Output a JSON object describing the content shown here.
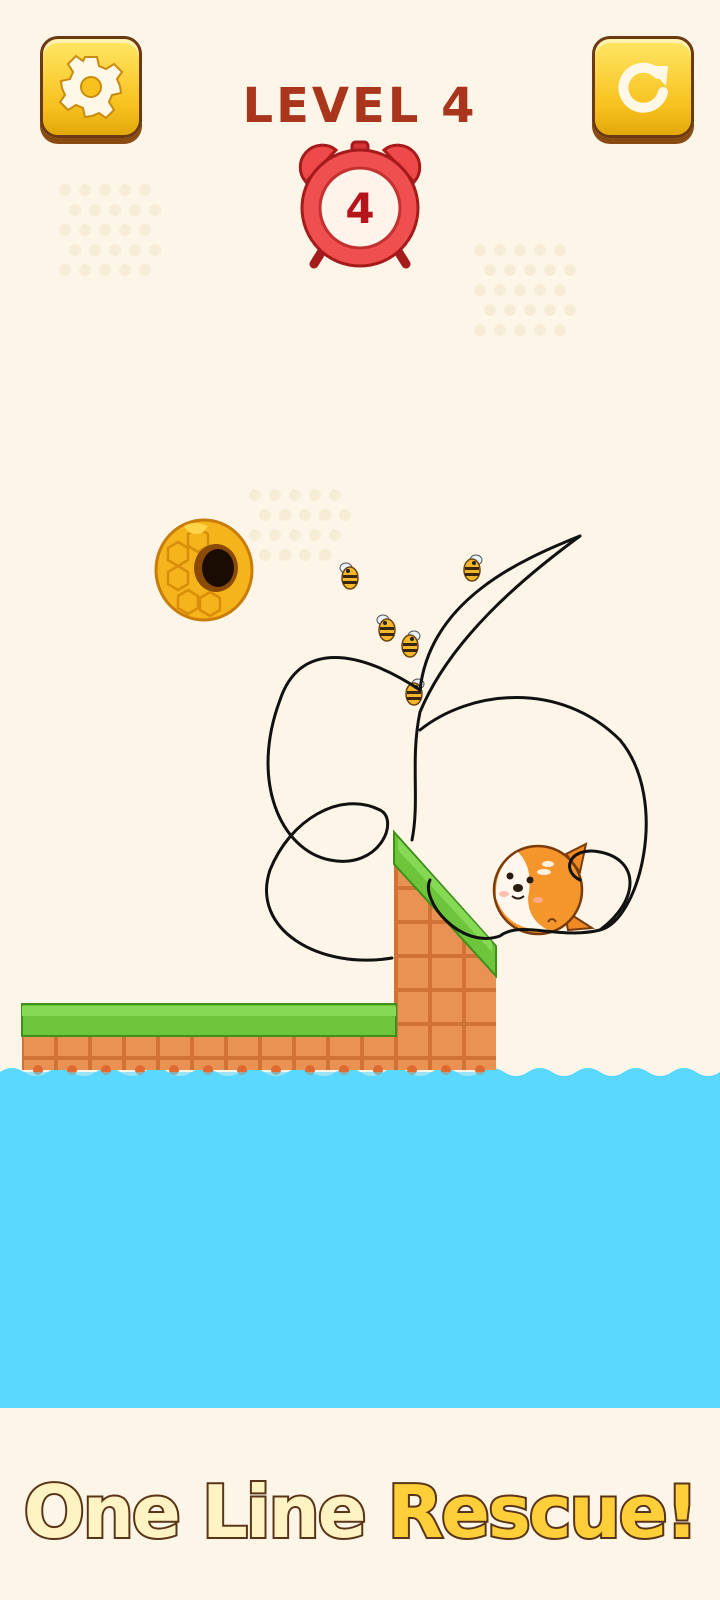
{
  "level": {
    "label": "LEVEL 4"
  },
  "timer": {
    "seconds": "4"
  },
  "buttons": {
    "settings_icon": "gear-icon",
    "restart_icon": "restart-icon"
  },
  "title": {
    "word1": "One",
    "word2": "Line",
    "word3": "Rescue!"
  },
  "colors": {
    "background": "#fdf6e8",
    "water": "#5ad8fd",
    "button": "#f7c11e",
    "grass": "#6cc53a",
    "dirt": "#e0884a",
    "level_text": "#a8351c"
  }
}
